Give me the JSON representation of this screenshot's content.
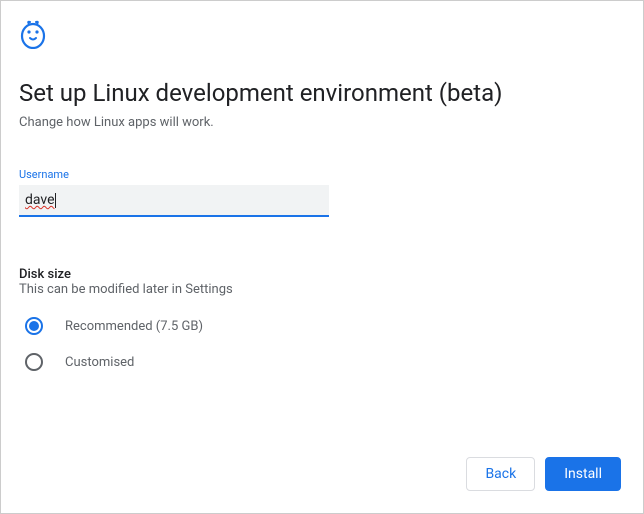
{
  "header": {
    "title": "Set up Linux development environment (beta)",
    "subtitle": "Change how Linux apps will work."
  },
  "username_field": {
    "label": "Username",
    "value": "dave"
  },
  "disk_section": {
    "title": "Disk size",
    "subtitle": "This can be modified later in Settings",
    "options": [
      {
        "label": "Recommended (7.5 GB)",
        "selected": true
      },
      {
        "label": "Customised",
        "selected": false
      }
    ]
  },
  "buttons": {
    "back": "Back",
    "install": "Install"
  },
  "colors": {
    "accent": "#1a73e8",
    "text_primary": "#202124",
    "text_secondary": "#5f6368"
  }
}
